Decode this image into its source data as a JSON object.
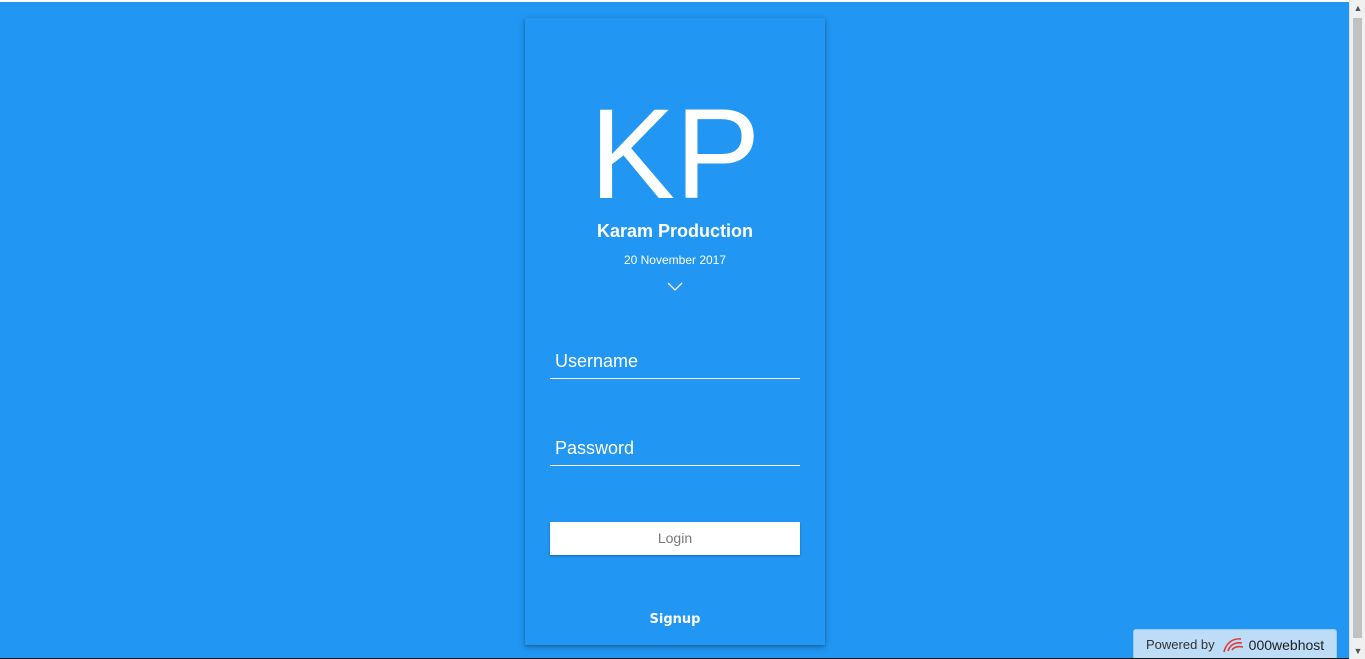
{
  "card": {
    "logo_text": "KP",
    "brand_name": "Karam Production",
    "date": "20 November 2017"
  },
  "form": {
    "username_placeholder": "Username",
    "password_placeholder": "Password",
    "login_label": "Login",
    "signup_label": "Signup"
  },
  "footer": {
    "powered_by_label": "Powered by",
    "host_name": "000webhost",
    "host_icon": "000webhost-logo-icon"
  },
  "colors": {
    "background": "#2196f3",
    "text": "#ffffff",
    "button_bg": "#ffffff",
    "button_text": "#7a7a7a",
    "host_logo": "#e53935"
  },
  "icons": {
    "chevron": "chevron-down-icon",
    "scroll_up": "scroll-up-arrow-icon",
    "scroll_down": "scroll-down-arrow-icon"
  }
}
